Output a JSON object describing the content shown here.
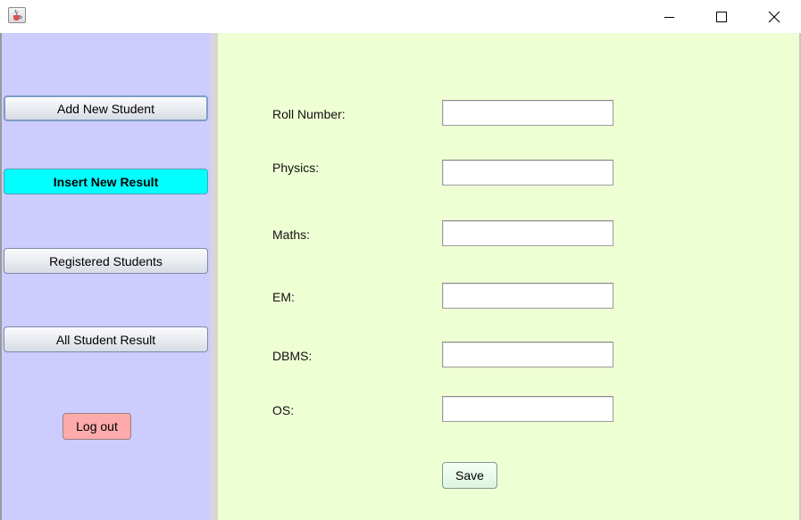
{
  "window": {
    "app_icon": "java-cup-icon",
    "controls": {
      "minimize": "minimize-icon",
      "maximize": "maximize-icon",
      "close": "close-icon"
    }
  },
  "sidebar": {
    "background": "#ccccff",
    "buttons": [
      {
        "label": "Add New Student",
        "state": "focused"
      },
      {
        "label": "Insert New Result",
        "state": "active",
        "color": "#00ffff"
      },
      {
        "label": "Registered Students",
        "state": "normal"
      },
      {
        "label": "All Student Result",
        "state": "normal"
      }
    ],
    "logout": {
      "label": "Log out",
      "color": "#ffaaaa"
    }
  },
  "form": {
    "background": "#efffd4",
    "fields": [
      {
        "label": "Roll Number:",
        "value": ""
      },
      {
        "label": "Physics:",
        "value": ""
      },
      {
        "label": "Maths:",
        "value": ""
      },
      {
        "label": "EM:",
        "value": ""
      },
      {
        "label": "DBMS:",
        "value": ""
      },
      {
        "label": "OS:",
        "value": ""
      }
    ],
    "save_label": "Save"
  }
}
